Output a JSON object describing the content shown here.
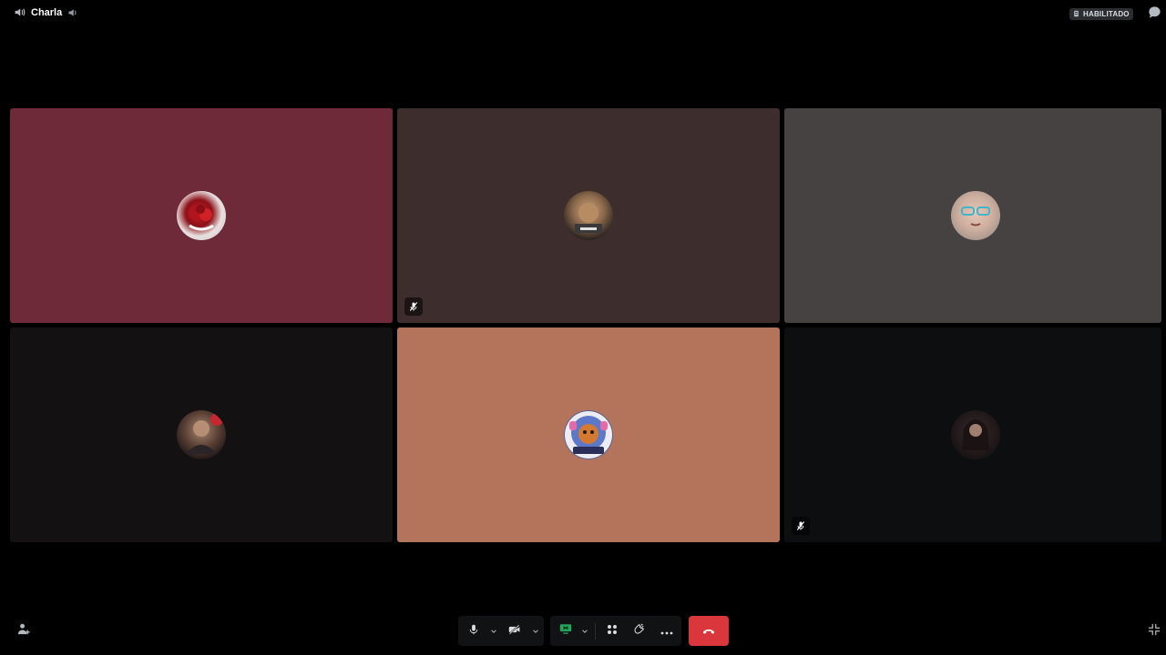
{
  "header": {
    "channel_name": "Charla",
    "status_label": "HABILITADO",
    "channel_icon": "speaker-icon",
    "volume_icon": "volume-icon",
    "chat_icon": "chat-bubble-icon"
  },
  "tiles": [
    {
      "name": "participant-1",
      "bg": "#6e2a39",
      "muted": false
    },
    {
      "name": "participant-2",
      "bg": "#3e2d2d",
      "muted": true
    },
    {
      "name": "participant-3",
      "bg": "#454241",
      "muted": false
    },
    {
      "name": "participant-4",
      "bg": "#141113",
      "muted": false
    },
    {
      "name": "participant-5",
      "bg": "#b3745b",
      "muted": false
    },
    {
      "name": "participant-6",
      "bg": "#0c0e10",
      "muted": true
    }
  ],
  "controls": {
    "mic_icon": "microphone-icon",
    "camera_icon": "camera-off-icon",
    "screenshare_icon": "screen-share-icon",
    "activities_icon": "activities-icon",
    "soundboard_icon": "soundboard-icon",
    "more_icon": "more-icon",
    "hangup_icon": "hang-up-icon",
    "hangup_color": "#da373c"
  },
  "corners": {
    "left_icon": "invite-user-icon",
    "right_icon": "fullscreen-exit-icon"
  }
}
